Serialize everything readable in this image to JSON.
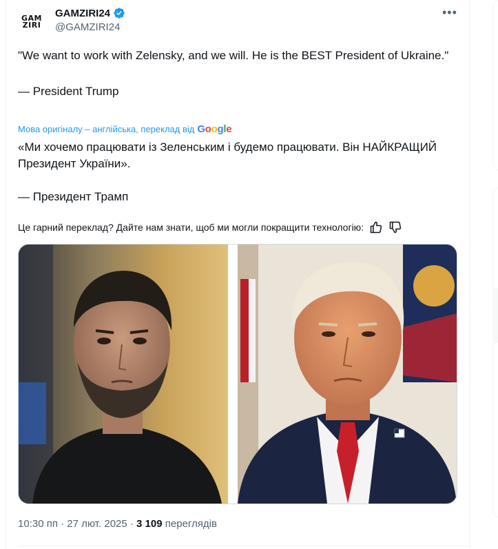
{
  "author": {
    "display_name": "GAMZIRI24",
    "handle": "@GAMZIRI24",
    "avatar_text_top": "GAM",
    "avatar_text_bottom": "ZIRI",
    "verified_color": "#1d9bf0"
  },
  "tweet": {
    "text": "\"We want to work with Zelensky, and we will. He is the BEST President of Ukraine.\"\n\n— President Trump",
    "translation_note": "Мова оригіналу – англійська, переклад від",
    "translation_provider": [
      "G",
      "o",
      "o",
      "g",
      "l",
      "e"
    ],
    "translated_text": "«Ми хочемо працювати із Зеленським і будемо працювати. Він НАЙКРАЩИЙ Президент України».\n\n— Президент Трамп",
    "feedback_prompt": "Це гарний переклад? Дайте нам знати, щоб ми могли покращити технологію:"
  },
  "meta": {
    "time_date": "10:30 пп · 27 лют. 2025 · ",
    "views_count": "3 109",
    "views_label": " переглядів"
  },
  "colors": {
    "accent": "#1d9bf0",
    "secondary_text": "#536471",
    "primary_text": "#0f1419"
  },
  "icons": {
    "more": "more-dots-icon",
    "verified": "verified-badge-icon",
    "thumb_up": "thumb-up-icon",
    "thumb_down": "thumb-down-icon"
  }
}
